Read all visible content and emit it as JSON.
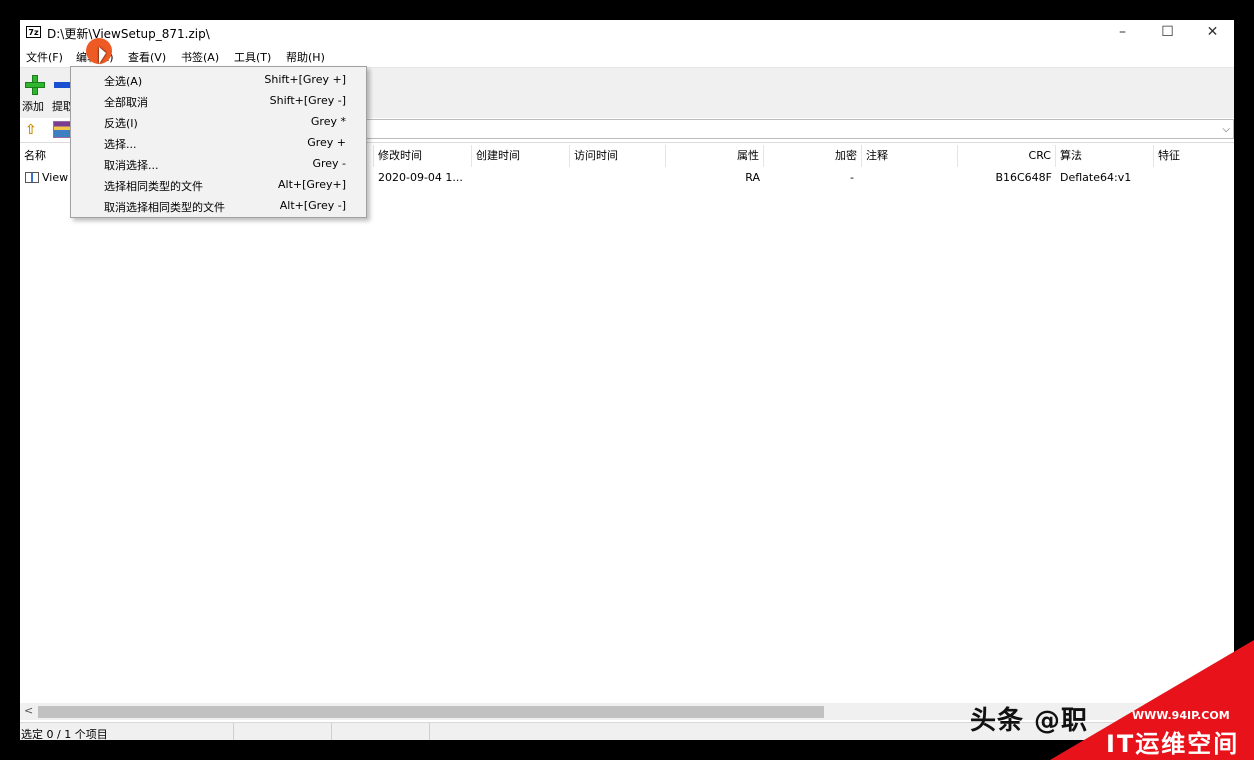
{
  "window": {
    "title": "D:\\更新\\ViewSetup_871.zip\\",
    "app_icon_text": "7z",
    "controls": {
      "minimize": "–",
      "maximize": "☐",
      "close": "✕"
    }
  },
  "menubar": {
    "items": [
      {
        "label": "文件(F)"
      },
      {
        "label": "编辑(E)"
      },
      {
        "label": "查看(V)"
      },
      {
        "label": "书签(A)"
      },
      {
        "label": "工具(T)"
      },
      {
        "label": "帮助(H)"
      }
    ]
  },
  "toolbar": {
    "add_label": "添加",
    "extract_label": "提取"
  },
  "address": {
    "value": "",
    "dropdown_icon": "chevron-down-icon"
  },
  "columns": [
    "名称",
    "修改时间",
    "创建时间",
    "访问时间",
    "属性",
    "加密",
    "注释",
    "CRC",
    "算法",
    "特征"
  ],
  "files": [
    {
      "name": "View",
      "modified": "2020-09-04 1...",
      "created": "",
      "accessed": "",
      "attributes": "RA",
      "encrypted": "-",
      "comment": "",
      "crc": "B16C648F",
      "method": "Deflate64:v1",
      "characteristics": ""
    }
  ],
  "edit_menu": {
    "items": [
      {
        "label": "全选(A)",
        "shortcut": "Shift+[Grey +]"
      },
      {
        "label": "全部取消",
        "shortcut": "Shift+[Grey -]"
      },
      {
        "label": "反选(I)",
        "shortcut": "Grey *"
      },
      {
        "label": "选择...",
        "shortcut": "Grey +"
      },
      {
        "label": "取消选择...",
        "shortcut": "Grey -"
      },
      {
        "label": "选择相同类型的文件",
        "shortcut": "Alt+[Grey+]"
      },
      {
        "label": "取消选择相同类型的文件",
        "shortcut": "Alt+[Grey -]"
      }
    ]
  },
  "scrollbar": {
    "left_arrow": "<"
  },
  "status": {
    "text": "选定 0 / 1 个项目"
  },
  "watermark": {
    "source": "头条 @职",
    "url": "WWW.94IP.COM",
    "brand": "IT运维空间",
    "brand_color": "#e8131a"
  }
}
